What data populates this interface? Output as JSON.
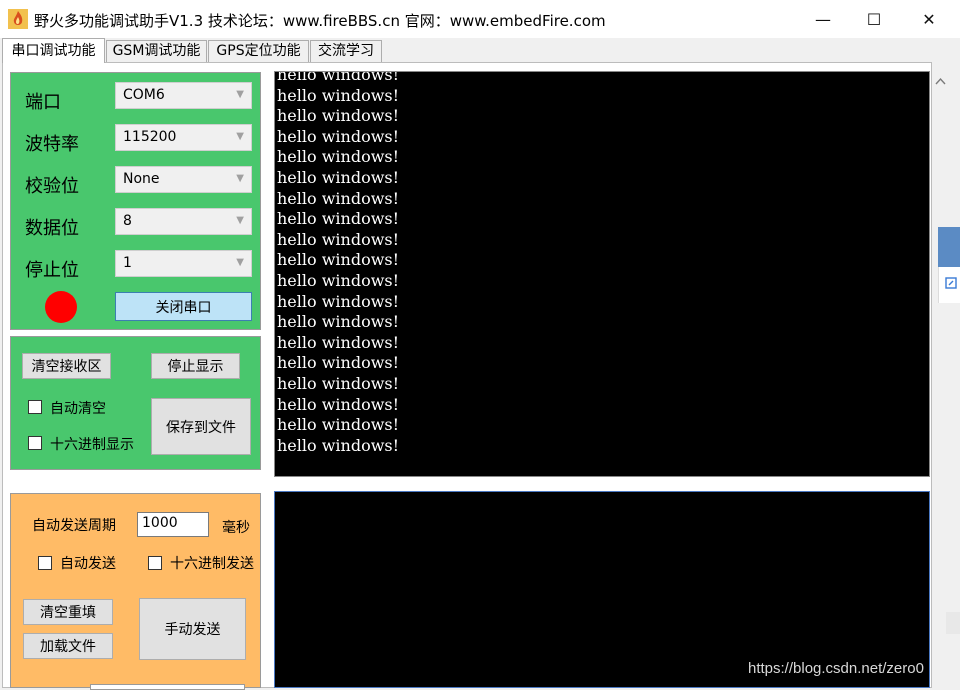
{
  "window": {
    "title": "野火多功能调试助手V1.3    技术论坛：www.fireBBS.cn   官网：www.embedFire.com",
    "minimize_glyph": "—",
    "maximize_glyph": "☐",
    "close_glyph": "✕"
  },
  "tabs": [
    {
      "label": "串口调试功能",
      "active": true
    },
    {
      "label": "GSM调试功能",
      "active": false
    },
    {
      "label": "GPS定位功能",
      "active": false
    },
    {
      "label": "交流学习",
      "active": false
    }
  ],
  "serial": {
    "port_label": "端口",
    "port_value": "COM6",
    "baud_label": "波特率",
    "baud_value": "115200",
    "parity_label": "校验位",
    "parity_value": "None",
    "databits_label": "数据位",
    "databits_value": "8",
    "stopbits_label": "停止位",
    "stopbits_value": "1",
    "close_button": "关闭串口",
    "indicator_color": "#ff0000"
  },
  "receive": {
    "clear_button": "清空接收区",
    "stop_button": "停止显示",
    "auto_clear_label": "自动清空",
    "hex_display_label": "十六进制显示",
    "save_button": "保存到文件",
    "lines": [
      "hello windows!",
      "hello windows!",
      "hello windows!",
      "hello windows!",
      "hello windows!",
      "hello windows!",
      "hello windows!",
      "hello windows!",
      "hello windows!",
      "hello windows!",
      "hello windows!",
      "hello windows!",
      "hello windows!",
      "hello windows!",
      "hello windows!",
      "hello windows!",
      "hello windows!",
      "hello windows!",
      "hello windows!"
    ]
  },
  "send": {
    "period_label": "自动发送周期",
    "period_value": "1000",
    "period_unit": "毫秒",
    "auto_send_label": "自动发送",
    "hex_send_label": "十六进制发送",
    "clear_button": "清空重填",
    "load_button": "加载文件",
    "send_button": "手动发送"
  },
  "watermark": "https://blog.csdn.net/zero0",
  "colors": {
    "serial_panel": "#49c76d",
    "send_panel": "#ffbb66",
    "terminal": "#000000"
  }
}
